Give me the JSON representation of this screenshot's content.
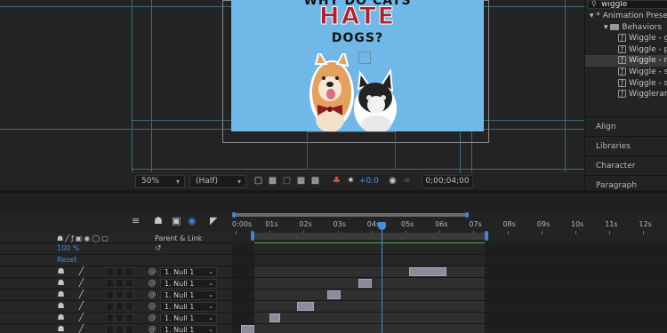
{
  "viewer": {
    "headline_line1": "WHY DO CATS",
    "headline_line2": "HATE",
    "headline_line3": "DOGS?",
    "headline_red": "#b2202c",
    "canvas_color": "#70b8e7",
    "zoom": "50%",
    "resolution": "(Half)",
    "exposure": "+0.0",
    "timecode": "0;00;04;00"
  },
  "effects": {
    "search_value": "wiggle",
    "tree": [
      {
        "label": "* Animation Presets",
        "kind": "folder-open",
        "indent": 0
      },
      {
        "label": "Behaviors",
        "kind": "folder",
        "indent": 1
      },
      {
        "label": "Wiggle - ge",
        "kind": "preset",
        "indent": 2
      },
      {
        "label": "Wiggle - pa",
        "kind": "preset",
        "indent": 2
      },
      {
        "label": "Wiggle - ro",
        "kind": "preset",
        "indent": 2,
        "selected": true
      },
      {
        "label": "Wiggle - sc",
        "kind": "preset",
        "indent": 2
      },
      {
        "label": "Wiggle - sk",
        "kind": "preset",
        "indent": 2
      },
      {
        "label": "Wiggleram",
        "kind": "preset",
        "indent": 2
      }
    ]
  },
  "panels": [
    "Align",
    "Libraries",
    "Character",
    "Paragraph"
  ],
  "timeline": {
    "header_parent": "Parent & Link",
    "scale_value": "100 %",
    "reset_label": "Reset",
    "time_labels": [
      "0:00s",
      "01s",
      "02s",
      "03s",
      "04s",
      "05s",
      "06s",
      "07s",
      "08s",
      "09s",
      "10s",
      "11s",
      "12s"
    ],
    "current_time_s": 4,
    "work_area_end_s": 7,
    "layers": [
      {
        "parent": "1. Null 1",
        "bar_start_s": 5.1,
        "bar_end_s": 6.2
      },
      {
        "parent": "1. Null 1",
        "bar_start_s": 3.6,
        "bar_end_s": 4.0
      },
      {
        "parent": "1. Null 1",
        "bar_start_s": 2.7,
        "bar_end_s": 3.1
      },
      {
        "parent": "1. Null 1",
        "bar_start_s": 1.8,
        "bar_end_s": 2.3
      },
      {
        "parent": "1. Null 1",
        "bar_start_s": 1.0,
        "bar_end_s": 1.3
      },
      {
        "parent": "1. Null 1",
        "bar_start_s": 0.15,
        "bar_end_s": 0.55
      }
    ]
  },
  "colors": {
    "accent_blue": "#2f7ae5",
    "time_green": "#4fae3c",
    "playhead": "#3d8fe0",
    "keyframe_bar": "#8b8b9b"
  }
}
